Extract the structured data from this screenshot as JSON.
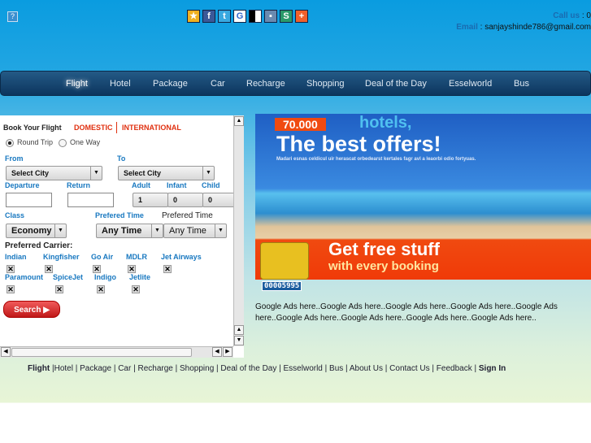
{
  "header": {
    "help_icon": "?",
    "social_icons": [
      "favorites-icon",
      "facebook-icon",
      "twitter-icon",
      "google-icon",
      "delicious-icon",
      "myspace-icon",
      "stumbleupon-icon",
      "addthis-icon"
    ],
    "call_label": "Call us",
    "call_value": ": 0",
    "email_label": "Email",
    "email_value": ": sanjayshinde786@gmail.com"
  },
  "nav": {
    "items": [
      "Flight",
      "Hotel",
      "Package",
      "Car",
      "Recharge",
      "Shopping",
      "Deal of the Day",
      "Esselworld",
      "Bus"
    ]
  },
  "form": {
    "title": "Book Your Flight",
    "domestic": "DOMESTIC",
    "international": "INTERNATIONAL",
    "round_trip": "Round Trip",
    "one_way": "One Way",
    "from": "From",
    "to": "To",
    "from_value": "Select City",
    "to_value": "Select City",
    "departure": "Departure",
    "return": "Return",
    "adult": "Adult",
    "infant": "Infant",
    "child": "Child",
    "adult_value": "1",
    "infant_value": "0",
    "child_value": "0",
    "class": "Class",
    "class_value": "Economy",
    "pref_time": "Prefered Time",
    "pref_time_value": "Any Time",
    "pref_time2": "Prefered Time",
    "pref_time2_value": "Any Time",
    "carrier_title": "Preferred Carrier:",
    "carriers1": [
      "Indian",
      "Kingfisher",
      "Go Air",
      "MDLR",
      "Jet Airways"
    ],
    "carriers2": [
      "Paramount",
      "SpiceJet",
      "Indigo",
      "Jetlite"
    ],
    "search": "Search"
  },
  "banner": {
    "badge": "70.000",
    "hotels": "hotels,",
    "headline": "The best offers!",
    "sub": "Madari esnas celdicul uir herascat orbedearst kertales fagr avl a leaorbi odio fortyuas.",
    "cta1": "Get free stuff",
    "cta2": "with every booking"
  },
  "counter": "00005995",
  "ads": "Google Ads here..Google Ads here..Google Ads here..Google Ads here..Google Ads here..Google Ads here..Google Ads here..Google Ads here..Google Ads here..",
  "footer": {
    "links": [
      "Flight",
      "Hotel",
      "Package",
      "Car",
      "Recharge",
      "Shopping",
      "Deal of the Day",
      "Esselworld",
      "Bus",
      "About Us",
      "Contact Us",
      "Feedback",
      "Sign In"
    ]
  }
}
